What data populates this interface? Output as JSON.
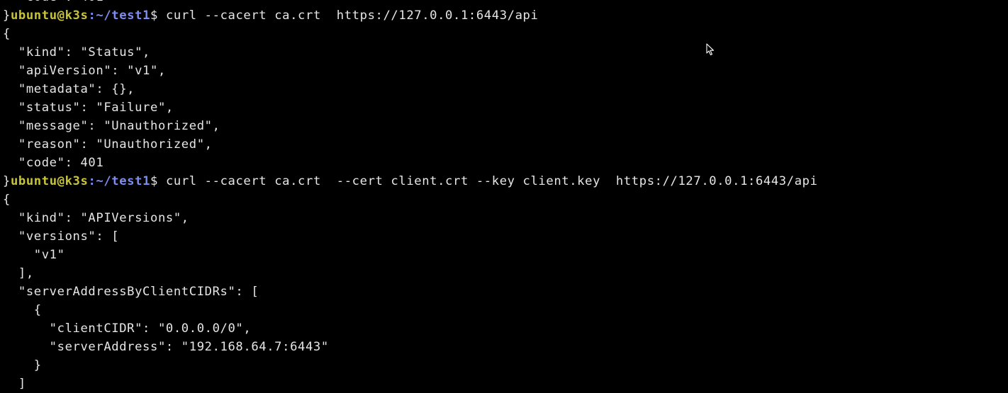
{
  "terminal": {
    "lines": [
      {
        "type": "output",
        "text": "  \"code\": 401"
      },
      {
        "type": "prompt",
        "prefix": "}",
        "user": "ubuntu@k3s",
        "sep": ":",
        "path": "~/test1",
        "suffix": "$ ",
        "command": "curl --cacert ca.crt  https://127.0.0.1:6443/api"
      },
      {
        "type": "output",
        "text": "{"
      },
      {
        "type": "output",
        "text": "  \"kind\": \"Status\","
      },
      {
        "type": "output",
        "text": "  \"apiVersion\": \"v1\","
      },
      {
        "type": "output",
        "text": "  \"metadata\": {},"
      },
      {
        "type": "output",
        "text": "  \"status\": \"Failure\","
      },
      {
        "type": "output",
        "text": "  \"message\": \"Unauthorized\","
      },
      {
        "type": "output",
        "text": "  \"reason\": \"Unauthorized\","
      },
      {
        "type": "output",
        "text": "  \"code\": 401"
      },
      {
        "type": "prompt",
        "prefix": "}",
        "user": "ubuntu@k3s",
        "sep": ":",
        "path": "~/test1",
        "suffix": "$ ",
        "command": "curl --cacert ca.crt  --cert client.crt --key client.key  https://127.0.0.1:6443/api"
      },
      {
        "type": "output",
        "text": "{"
      },
      {
        "type": "output",
        "text": "  \"kind\": \"APIVersions\","
      },
      {
        "type": "output",
        "text": "  \"versions\": ["
      },
      {
        "type": "output",
        "text": "    \"v1\""
      },
      {
        "type": "output",
        "text": "  ],"
      },
      {
        "type": "output",
        "text": "  \"serverAddressByClientCIDRs\": ["
      },
      {
        "type": "output",
        "text": "    {"
      },
      {
        "type": "output",
        "text": "      \"clientCIDR\": \"0.0.0.0/0\","
      },
      {
        "type": "output",
        "text": "      \"serverAddress\": \"192.168.64.7:6443\""
      },
      {
        "type": "output",
        "text": "    }"
      },
      {
        "type": "output",
        "text": "  ]"
      }
    ]
  },
  "cursor": {
    "icon": "mouse-pointer-icon"
  }
}
